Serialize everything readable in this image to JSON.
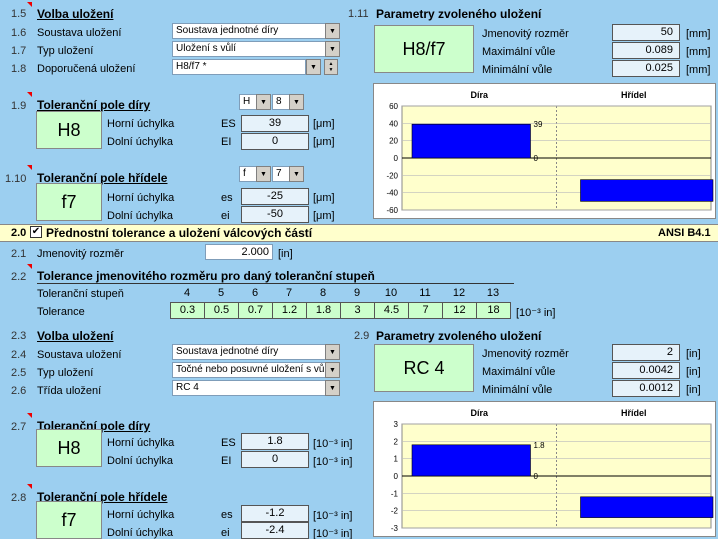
{
  "sec1": {
    "num_1_5": "1.5",
    "title": "Volba uložení",
    "num_1_6": "1.6",
    "system_label": "Soustava uložení",
    "system_value": "Soustava jednotné díry",
    "num_1_7": "1.7",
    "type_label": "Typ uložení",
    "type_value": "Uložení s vůlí",
    "num_1_8": "1.8",
    "recommended_label": "Doporučená uložení",
    "recommended_value": "H8/f7 *",
    "num_1_9": "1.9",
    "hole_title": "Toleranční pole díry",
    "hole_letter": "H",
    "hole_grade": "8",
    "hole_badge": "H8",
    "upper_label": "Horní úchylka",
    "lower_label": "Dolní úchylka",
    "hole_es_label": "ES",
    "hole_es_value": "39",
    "hole_ei_label": "EI",
    "hole_ei_value": "0",
    "unit_um": "[μm]",
    "num_1_10": "1.10",
    "shaft_title": "Toleranční pole hřídele",
    "shaft_letter": "f",
    "shaft_grade": "7",
    "shaft_badge": "f7",
    "shaft_es_label": "es",
    "shaft_es_value": "-25",
    "shaft_ei_label": "ei",
    "shaft_ei_value": "-50",
    "num_1_11": "1.11",
    "params_title": "Parametry zvoleného uložení",
    "fit_badge": "H8/f7",
    "nominal_label": "Jmenovitý rozměr",
    "nominal_value": "50",
    "nominal_unit": "[mm]",
    "max_label": "Maximální vůle",
    "max_value": "0.089",
    "max_unit": "[mm]",
    "min_label": "Minimální vůle",
    "min_value": "0.025",
    "min_unit": "[mm]"
  },
  "sec2": {
    "num_2_0": "2.0",
    "checkbox_mark": "✔",
    "title": "Přednostní tolerance a uložení válcových částí",
    "standard": "ANSI B4.1",
    "num_2_1": "2.1",
    "nominal_label": "Jmenovitý rozměr",
    "nominal_value": "2.000",
    "nominal_unit": "[in]",
    "num_2_2": "2.2",
    "tol_title": "Tolerance jmenovitého rozměru pro daný toleranční stupeň",
    "grade_label": "Toleranční stupeň",
    "tol_label": "Tolerance",
    "tol_unit": "[10⁻³ in]",
    "grades": [
      "4",
      "5",
      "6",
      "7",
      "8",
      "9",
      "10",
      "11",
      "12",
      "13"
    ],
    "tolerances": [
      "0.3",
      "0.5",
      "0.7",
      "1.2",
      "1.8",
      "3",
      "4.5",
      "7",
      "12",
      "18"
    ],
    "num_2_3": "2.3",
    "fit_title": "Volba uložení",
    "num_2_4": "2.4",
    "system_label": "Soustava uložení",
    "system_value": "Soustava jednotné díry",
    "num_2_5": "2.5",
    "type_label": "Typ uložení",
    "type_value": "Točné nebo posuvné uložení s vůlí",
    "num_2_6": "2.6",
    "class_label": "Třída uložení",
    "class_value": "RC 4",
    "num_2_7": "2.7",
    "hole_title": "Toleranční pole díry",
    "hole_badge": "H8",
    "upper_label": "Horní úchylka",
    "lower_label": "Dolní úchylka",
    "hole_es_label": "ES",
    "hole_es_value": "1.8",
    "hole_ei_label": "EI",
    "hole_ei_value": "0",
    "unit_in3": "[10⁻³ in]",
    "num_2_8": "2.8",
    "shaft_title": "Toleranční pole hřídele",
    "shaft_badge": "f7",
    "shaft_es_label": "es",
    "shaft_es_value": "-1.2",
    "shaft_ei_label": "ei",
    "shaft_ei_value": "-2.4",
    "num_2_9": "2.9",
    "params_title": "Parametry zvoleného uložení",
    "fit_badge": "RC 4",
    "nominal2_label": "Jmenovitý rozměr",
    "nominal2_value": "2",
    "nominal2_unit": "[in]",
    "max_label": "Maximální vůle",
    "max_value": "0.0042",
    "max_unit": "[in]",
    "min_label": "Minimální vůle",
    "min_value": "0.0012",
    "min_unit": "[in]"
  },
  "chart_data": [
    {
      "type": "bar",
      "columns": [
        "Díra",
        "Hřídel"
      ],
      "series": [
        {
          "values": [
            [
              0,
              39
            ],
            [
              -50,
              -25
            ]
          ]
        }
      ],
      "bar_labels": [
        [
          "39",
          "0"
        ],
        [
          "-25",
          "-50"
        ]
      ],
      "yticks": [
        60,
        40,
        20,
        0,
        -20,
        -40,
        -60
      ],
      "ylim": [
        -60,
        60
      ],
      "grid": true,
      "bar_color": "#0000ff",
      "background": "#ffffcc"
    },
    {
      "type": "bar",
      "columns": [
        "Díra",
        "Hřídel"
      ],
      "series": [
        {
          "values": [
            [
              0,
              1.8
            ],
            [
              -2.4,
              -1.2
            ]
          ]
        }
      ],
      "bar_labels": [
        [
          "1.8",
          "0"
        ],
        [
          "-1.2",
          "-2.4"
        ]
      ],
      "yticks": [
        3,
        2,
        1,
        0,
        -1,
        -2,
        -3
      ],
      "ylim": [
        -3,
        3
      ],
      "grid": true,
      "bar_color": "#0000ff",
      "background": "#ffffcc"
    }
  ]
}
